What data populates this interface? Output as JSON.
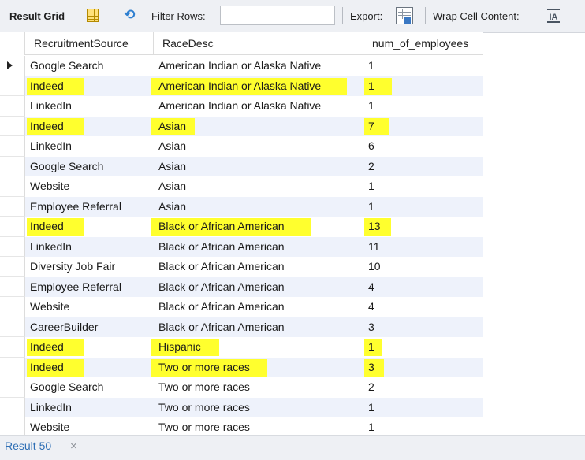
{
  "toolbar": {
    "title": "Result Grid",
    "grid_icon": "grid-view-icon",
    "filter_icon": "filter-refresh-icon",
    "filter_label": "Filter Rows:",
    "filter_value": "",
    "export_label": "Export:",
    "export_icon": "export-icon",
    "wrap_label": "Wrap Cell Content:",
    "wrap_icon": "wrap-text-icon",
    "wrap_icon_glyph": "IA"
  },
  "grid": {
    "columns": [
      "RecruitmentSource",
      "RaceDesc",
      "num_of_employees"
    ],
    "highlight_color": "#ffff2e",
    "alt_row_color": "#eef2fb",
    "rows": [
      {
        "source": "Google Search",
        "race": "American Indian or Alaska Native",
        "count": "1",
        "highlighted": false
      },
      {
        "source": "Indeed",
        "race": "American Indian or Alaska Native",
        "count": "1",
        "highlighted": true
      },
      {
        "source": "LinkedIn",
        "race": "American Indian or Alaska Native",
        "count": "1",
        "highlighted": false
      },
      {
        "source": "Indeed",
        "race": "Asian",
        "count": "7",
        "highlighted": true
      },
      {
        "source": "LinkedIn",
        "race": "Asian",
        "count": "6",
        "highlighted": false
      },
      {
        "source": "Google Search",
        "race": "Asian",
        "count": "2",
        "highlighted": false
      },
      {
        "source": "Website",
        "race": "Asian",
        "count": "1",
        "highlighted": false
      },
      {
        "source": "Employee Referral",
        "race": "Asian",
        "count": "1",
        "highlighted": false
      },
      {
        "source": "Indeed",
        "race": "Black or African American",
        "count": "13",
        "highlighted": true
      },
      {
        "source": "LinkedIn",
        "race": "Black or African American",
        "count": "11",
        "highlighted": false
      },
      {
        "source": "Diversity Job Fair",
        "race": "Black or African American",
        "count": "10",
        "highlighted": false
      },
      {
        "source": "Employee Referral",
        "race": "Black or African American",
        "count": "4",
        "highlighted": false
      },
      {
        "source": "Website",
        "race": "Black or African American",
        "count": "4",
        "highlighted": false
      },
      {
        "source": "CareerBuilder",
        "race": "Black or African American",
        "count": "3",
        "highlighted": false
      },
      {
        "source": "Indeed",
        "race": "Hispanic",
        "count": "1",
        "highlighted": true
      },
      {
        "source": "Indeed",
        "race": "Two or more races",
        "count": "3",
        "highlighted": true
      },
      {
        "source": "Google Search",
        "race": "Two or more races",
        "count": "2",
        "highlighted": false
      },
      {
        "source": "LinkedIn",
        "race": "Two or more races",
        "count": "1",
        "highlighted": false
      },
      {
        "source": "Website",
        "race": "Two or more races",
        "count": "1",
        "highlighted": false
      }
    ]
  },
  "bottom_tabs": {
    "result_tab": "Result 50",
    "close_glyph": "×",
    "close_icon": "close-icon"
  }
}
